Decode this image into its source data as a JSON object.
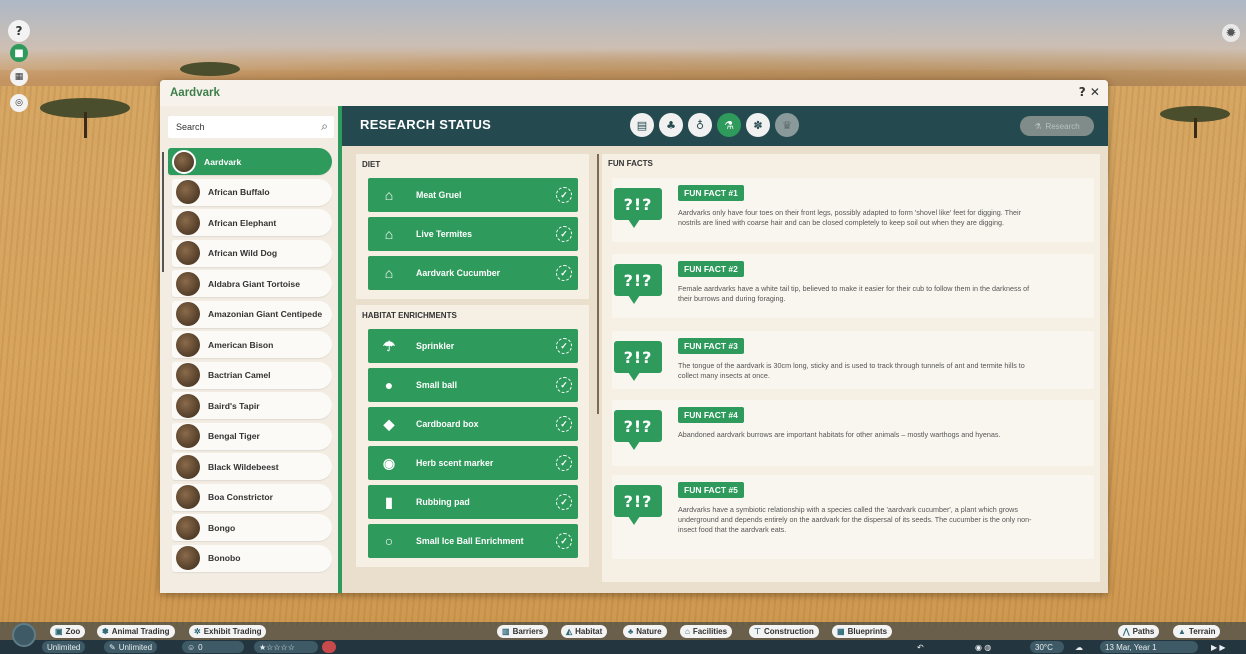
{
  "window": {
    "title": "Aardvark",
    "controls": "? ✕"
  },
  "search": {
    "placeholder": "Search"
  },
  "animals": [
    "Aardvark",
    "African Buffalo",
    "African Elephant",
    "African Wild Dog",
    "Aldabra Giant Tortoise",
    "Amazonian Giant Centipede",
    "American Bison",
    "Bactrian Camel",
    "Baird's Tapir",
    "Bengal Tiger",
    "Black Wildebeest",
    "Boa Constrictor",
    "Bongo",
    "Bonobo"
  ],
  "header": {
    "title": "RESEARCH STATUS",
    "research_button": "Research"
  },
  "tabs": [
    "notepad-icon",
    "tree-icon",
    "bag-icon",
    "flask-icon",
    "paw-icon",
    "trophy-icon"
  ],
  "diet": {
    "heading": "DIET",
    "items": [
      "Meat Gruel",
      "Live Termites",
      "Aardvark Cucumber"
    ]
  },
  "enrichments": {
    "heading": "HABITAT ENRICHMENTS",
    "items": [
      "Sprinkler",
      "Small ball",
      "Cardboard box",
      "Herb scent marker",
      "Rubbing pad",
      "Small Ice Ball Enrichment"
    ]
  },
  "fun_facts": {
    "heading": "FUN FACTS",
    "bubble": "?!?",
    "items": [
      {
        "title": "FUN FACT #1",
        "text": "Aardvarks only have four toes on their front legs, possibly adapted to form 'shovel like' feet for digging. Their nostrils are lined with coarse hair and can be closed completely to keep soil out when they are digging."
      },
      {
        "title": "FUN FACT #2",
        "text": "Female aardvarks have a white tail tip, believed to make it easier for their cub to follow them in the darkness of their burrows and during foraging."
      },
      {
        "title": "FUN FACT #3",
        "text": "The tongue of the aardvark is 30cm long, sticky and is used to track through tunnels of ant and termite hills to collect many insects at once."
      },
      {
        "title": "FUN FACT #4",
        "text": "Abandoned aardvark burrows are important habitats for other animals – mostly warthogs and hyenas."
      },
      {
        "title": "FUN FACT #5",
        "text": "Aardvarks have a symbiotic relationship with a species called the 'aardvark cucumber', a plant which grows underground and depends entirely on the aardvark for the dispersal of its seeds. The cucumber is the only non-insect food that the aardvark eats."
      }
    ]
  },
  "bottom": {
    "left_tabs": [
      "Zoo",
      "Animal Trading",
      "Exhibit Trading"
    ],
    "center_tabs": [
      "Barriers",
      "Habitat",
      "Nature",
      "Facilities",
      "Construction",
      "Blueprints"
    ],
    "right_tabs": [
      "Paths",
      "Terrain"
    ],
    "money": "Unlimited",
    "research": "Unlimited",
    "guests": "0",
    "temperature": "30°C",
    "date": "13 Mar, Year 1"
  }
}
